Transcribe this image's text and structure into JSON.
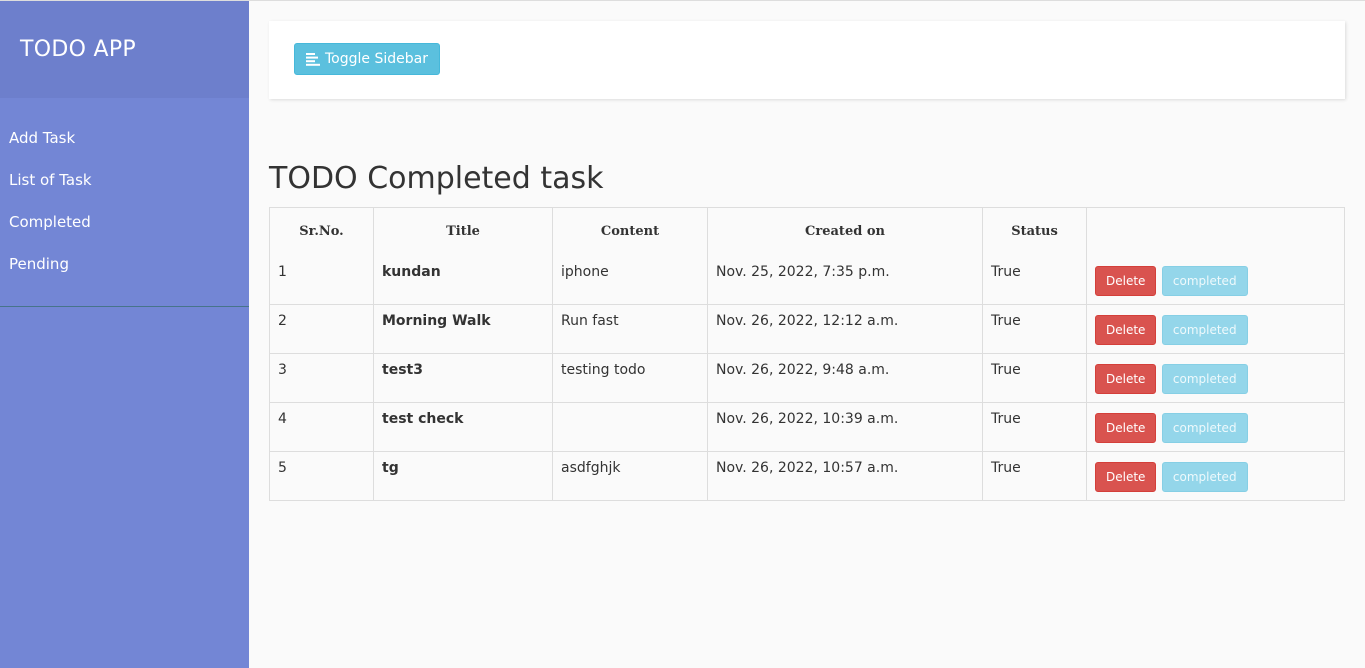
{
  "sidebar": {
    "title": "TODO APP",
    "items": [
      {
        "label": "Add Task"
      },
      {
        "label": "List of Task"
      },
      {
        "label": "Completed"
      },
      {
        "label": "Pending"
      }
    ]
  },
  "navbar": {
    "toggle_label": "Toggle Sidebar",
    "toggle_icon": "align-left-icon"
  },
  "main": {
    "title": "TODO Completed task",
    "table": {
      "columns": [
        "Sr.No.",
        "Title",
        "Content",
        "Created on",
        "Status",
        ""
      ],
      "rows": [
        {
          "sr": "1",
          "title": "kundan",
          "content": "iphone",
          "created": "Nov. 25, 2022, 7:35 p.m.",
          "status": "True",
          "delete_label": "Delete",
          "completed_label": "completed"
        },
        {
          "sr": "2",
          "title": "Morning Walk",
          "content": "Run fast",
          "created": "Nov. 26, 2022, 12:12 a.m.",
          "status": "True",
          "delete_label": "Delete",
          "completed_label": "completed"
        },
        {
          "sr": "3",
          "title": "test3",
          "content": "testing todo",
          "created": "Nov. 26, 2022, 9:48 a.m.",
          "status": "True",
          "delete_label": "Delete",
          "completed_label": "completed"
        },
        {
          "sr": "4",
          "title": "test check",
          "content": "",
          "created": "Nov. 26, 2022, 10:39 a.m.",
          "status": "True",
          "delete_label": "Delete",
          "completed_label": "completed"
        },
        {
          "sr": "5",
          "title": "tg",
          "content": "asdfghjk",
          "created": "Nov. 26, 2022, 10:57 a.m.",
          "status": "True",
          "delete_label": "Delete",
          "completed_label": "completed"
        }
      ]
    }
  },
  "colors": {
    "sidebar_bg": "#7386d5",
    "sidebar_header_bg": "#6d7fcc",
    "info": "#5bc0de",
    "danger": "#d9534f"
  }
}
